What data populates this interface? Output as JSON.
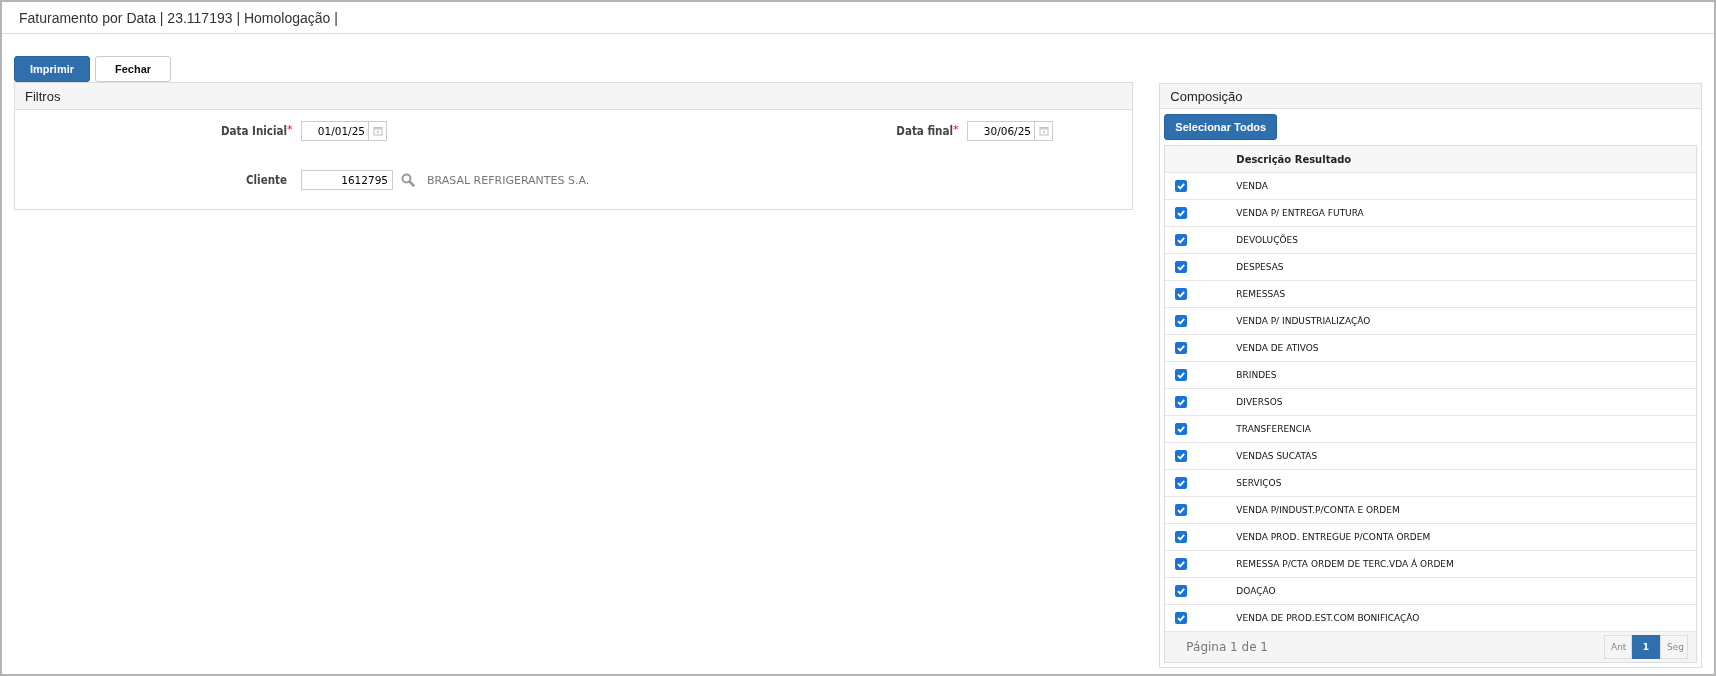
{
  "window": {
    "title": "Faturamento por Data | 23.117193 | Homologação |"
  },
  "buttons": [
    {
      "label": "Imprimir",
      "kind": "primary"
    },
    {
      "label": "Fechar",
      "kind": "default"
    }
  ],
  "filters": {
    "title": "Filtros",
    "date_start": {
      "label": "Data Inicial",
      "required_mark": "*",
      "value": "01/01/25"
    },
    "date_end": {
      "label": "Data final",
      "required_mark": "*",
      "value": "30/06/25"
    },
    "client": {
      "label": "Cliente",
      "value": "1612795",
      "name": "BRASAL REFRIGERANTES S.A."
    }
  },
  "composition": {
    "title": "Composição",
    "select_all": "Selecionar Todos",
    "table": {
      "columns": [
        "Descrição Resultado"
      ],
      "rows": [
        {
          "checked": true,
          "description": "VENDA"
        },
        {
          "checked": true,
          "description": "VENDA P/ ENTREGA FUTURA"
        },
        {
          "checked": true,
          "description": "DEVOLUÇÕES"
        },
        {
          "checked": true,
          "description": "DESPESAS"
        },
        {
          "checked": true,
          "description": "REMESSAS"
        },
        {
          "checked": true,
          "description": "VENDA P/ INDUSTRIALIZAÇÃO"
        },
        {
          "checked": true,
          "description": "VENDA DE ATIVOS"
        },
        {
          "checked": true,
          "description": "BRINDES"
        },
        {
          "checked": true,
          "description": "DIVERSOS"
        },
        {
          "checked": true,
          "description": "TRANSFERENCIA"
        },
        {
          "checked": true,
          "description": "VENDAS SUCATAS"
        },
        {
          "checked": true,
          "description": "SERVIÇOS"
        },
        {
          "checked": true,
          "description": "VENDA P/INDUST.P/CONTA E ORDEM"
        },
        {
          "checked": true,
          "description": "VENDA PROD. ENTREGUE P/CONTA ORDEM"
        },
        {
          "checked": true,
          "description": "REMESSA P/CTA ORDEM DE TERC.VDA Á ORDEM"
        },
        {
          "checked": true,
          "description": "DOAÇÃO"
        },
        {
          "checked": true,
          "description": "VENDA DE PROD.EST.COM BONIFICAÇÃO"
        }
      ]
    },
    "pagination": {
      "info": "Página 1 de 1",
      "prev": {
        "label": "Ant",
        "disabled": true
      },
      "pages": [
        {
          "label": "1",
          "selected": true
        }
      ],
      "next": {
        "label": "Seg",
        "disabled": true
      }
    }
  }
}
